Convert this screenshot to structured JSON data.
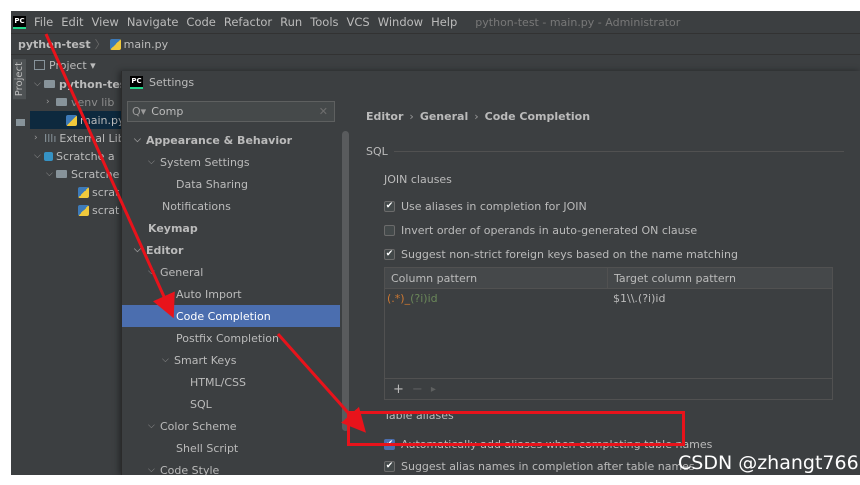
{
  "menubar": {
    "logo": "PC",
    "items": [
      "File",
      "Edit",
      "View",
      "Navigate",
      "Code",
      "Refactor",
      "Run",
      "Tools",
      "VCS",
      "Window",
      "Help"
    ],
    "window_title": "python-test - main.py - Administrator"
  },
  "navbar": {
    "project": "python-test",
    "file": "main.py"
  },
  "toolstrip": {
    "label": "Project"
  },
  "project_panel": {
    "header": "Project ▾",
    "items": [
      {
        "label": "python-tes"
      },
      {
        "label": "venv lib"
      },
      {
        "label": "main.py"
      },
      {
        "label": "External Lib"
      },
      {
        "label": "Scratche a"
      },
      {
        "label": "Scratche"
      },
      {
        "label": "scrat"
      },
      {
        "label": "scrat"
      }
    ]
  },
  "dialog": {
    "title": "Settings",
    "search": {
      "value": "Comp",
      "icon": "search-icon"
    },
    "tree": [
      {
        "label": "Appearance & Behavior"
      },
      {
        "label": "System Settings"
      },
      {
        "label": "Data Sharing"
      },
      {
        "label": "Notifications"
      },
      {
        "label": "Keymap"
      },
      {
        "label": "Editor"
      },
      {
        "label": "General"
      },
      {
        "label": "Auto Import"
      },
      {
        "label": "Code Completion"
      },
      {
        "label": "Postfix Completion"
      },
      {
        "label": "Smart Keys"
      },
      {
        "label": "HTML/CSS"
      },
      {
        "label": "SQL"
      },
      {
        "label": "Color Scheme"
      },
      {
        "label": "Shell Script"
      },
      {
        "label": "Code Style"
      }
    ]
  },
  "content": {
    "breadcrumb": [
      "Editor",
      "General",
      "Code Completion"
    ],
    "sql_section": "SQL",
    "join_label": "JOIN clauses",
    "checkboxes": [
      {
        "label": "Use aliases in completion for JOIN",
        "checked": true
      },
      {
        "label": "Invert order of operands in auto-generated ON clause",
        "checked": false
      },
      {
        "label": "Suggest non-strict foreign keys based on the name matching",
        "checked": true
      }
    ],
    "table": {
      "headers": [
        "Column pattern",
        "Target column pattern"
      ],
      "rows": [
        {
          "pattern_a": "(.*)_",
          "pattern_b": "(?i)id",
          "target": "$1\\\\.(?i)id"
        }
      ],
      "toolbar": [
        "+",
        "−",
        "▸"
      ]
    },
    "table_aliases_label": "Table aliases",
    "alias_checkboxes": [
      {
        "label": "Automatically add aliases when completing table names",
        "checked": true
      },
      {
        "label": "Suggest alias names in completion after table names",
        "checked": true
      }
    ]
  },
  "watermark": "CSDN @zhangt766",
  "colors": {
    "ide_bg": "#3c3f41",
    "selection": "#4b6eaf",
    "annotation": "#e8131b",
    "pattern_green": "#6a8759",
    "pattern_orange": "#cc7832"
  }
}
